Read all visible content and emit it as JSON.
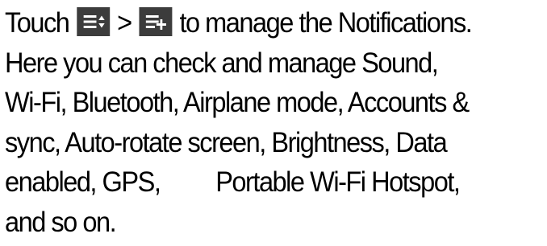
{
  "paragraph": {
    "line1": {
      "before": "Touch ",
      "separator": " > ",
      "after": " to manage the Notifications."
    },
    "line2": "Here you can check and manage Sound,",
    "line3": "Wi-Fi, Bluetooth, Airplane mode, Accounts &",
    "line4": "sync, Auto-rotate screen, Brightness, Data",
    "line5": {
      "before": "enabled, GPS,",
      "after": "Portable Wi-Fi Hotspot,"
    },
    "line6": "and so on."
  },
  "icons": {
    "first": "reorder-settings-icon",
    "second": "add-settings-icon",
    "icon_color": "#3c3c3c",
    "glyph_color": "#ffffff"
  }
}
